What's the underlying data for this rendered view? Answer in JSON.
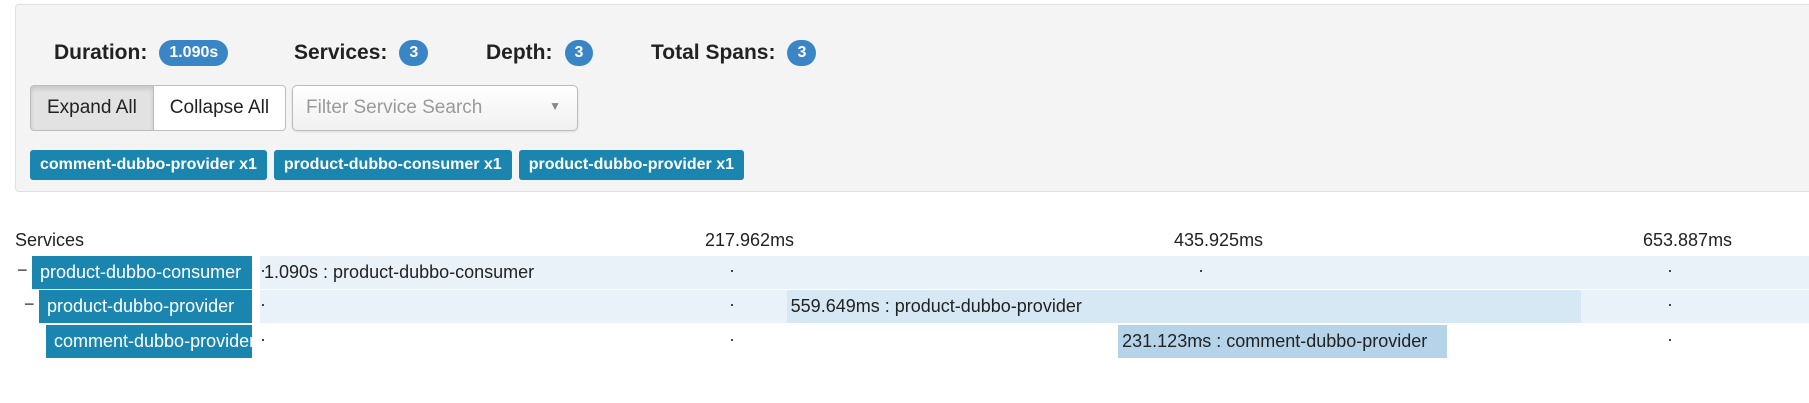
{
  "summary": {
    "duration_label": "Duration:",
    "duration_value": "1.090s",
    "services_label": "Services:",
    "services_value": "3",
    "depth_label": "Depth:",
    "depth_value": "3",
    "total_spans_label": "Total Spans:",
    "total_spans_value": "3"
  },
  "controls": {
    "expand_all": "Expand All",
    "collapse_all": "Collapse All",
    "filter_placeholder": "Filter Service Search"
  },
  "service_tags": [
    "comment-dubbo-provider x1",
    "product-dubbo-consumer x1",
    "product-dubbo-provider x1"
  ],
  "timeline": {
    "services_header": "Services",
    "ticks": [
      "217.962ms",
      "435.925ms",
      "653.887ms"
    ],
    "rows": [
      {
        "toggle": "−",
        "service": "product-dubbo-consumer",
        "span_label": "1.090s : product-dubbo-consumer",
        "start_fraction": 0.0,
        "duration_fraction": 1.0
      },
      {
        "toggle": "−",
        "service": "product-dubbo-provider",
        "span_label": "559.649ms : product-dubbo-provider",
        "start_fraction": 0.34,
        "duration_fraction": 0.513
      },
      {
        "toggle": "",
        "service": "comment-dubbo-provider",
        "span_label": "231.123ms : comment-dubbo-provider",
        "start_fraction": 0.554,
        "duration_fraction": 0.212
      }
    ]
  },
  "colors": {
    "badge": "#3a85c6",
    "tag": "#1a86b0",
    "row_bg": "#eaf2f9",
    "bar_level_1": "#eaf2f9",
    "bar_level_2": "#d6e8f3",
    "bar_level_3": "#b5d4ea"
  }
}
